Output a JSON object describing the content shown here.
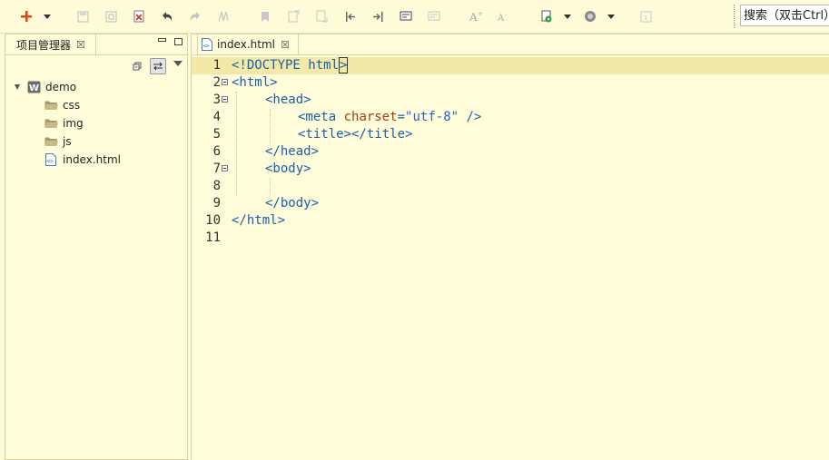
{
  "toolbar": {
    "search_text": "搜索（双击Ctrl）",
    "buttons": [
      {
        "name": "new-icon",
        "color": "#e0421b"
      },
      {
        "name": "save-icon"
      },
      {
        "name": "save-all-icon"
      },
      {
        "name": "close-file-icon",
        "color": "#c0392b"
      },
      {
        "name": "undo-icon"
      },
      {
        "name": "redo-icon"
      },
      {
        "name": "format-icon"
      },
      {
        "name": "bookmark-icon"
      },
      {
        "name": "prev-bookmark-icon"
      },
      {
        "name": "next-bookmark-icon"
      },
      {
        "name": "goto-start-icon"
      },
      {
        "name": "goto-end-icon"
      },
      {
        "name": "comment-icon"
      },
      {
        "name": "uncomment-icon"
      },
      {
        "name": "font-increase-icon"
      },
      {
        "name": "font-decrease-icon"
      },
      {
        "name": "run-browser-icon",
        "color": "#2e9a3c"
      },
      {
        "name": "publish-icon"
      },
      {
        "name": "plugin-icon"
      }
    ]
  },
  "project_panel": {
    "title": "项目管理器",
    "close_symbol": "☒",
    "tree": [
      {
        "label": "demo",
        "icon": "web-project-icon",
        "level": 0,
        "expanded": true
      },
      {
        "label": "css",
        "icon": "folder-icon",
        "level": 1
      },
      {
        "label": "img",
        "icon": "folder-icon",
        "level": 1
      },
      {
        "label": "js",
        "icon": "folder-icon",
        "level": 1
      },
      {
        "label": "index.html",
        "icon": "html-file-icon",
        "level": 1
      }
    ]
  },
  "editor": {
    "tab_label": "index.html",
    "close_symbol": "☒",
    "current_line": 1,
    "lines": [
      {
        "n": "1"
      },
      {
        "n": "2"
      },
      {
        "n": "3"
      },
      {
        "n": "4"
      },
      {
        "n": "5"
      },
      {
        "n": "6"
      },
      {
        "n": "7"
      },
      {
        "n": "8"
      },
      {
        "n": "9"
      },
      {
        "n": "10"
      },
      {
        "n": "11"
      }
    ],
    "code": {
      "l1a": "<!DOCTYPE html",
      "l1b": ">",
      "l2": "<html>",
      "l3": "<head>",
      "l4a": "<meta",
      "l4b": "charset",
      "l4c": "=",
      "l4d": "\"utf-8\"",
      "l4e": " />",
      "l5": "<title></title>",
      "l6": "</head>",
      "l7": "<body>",
      "l9": "</body>",
      "l10": "</html>"
    }
  }
}
